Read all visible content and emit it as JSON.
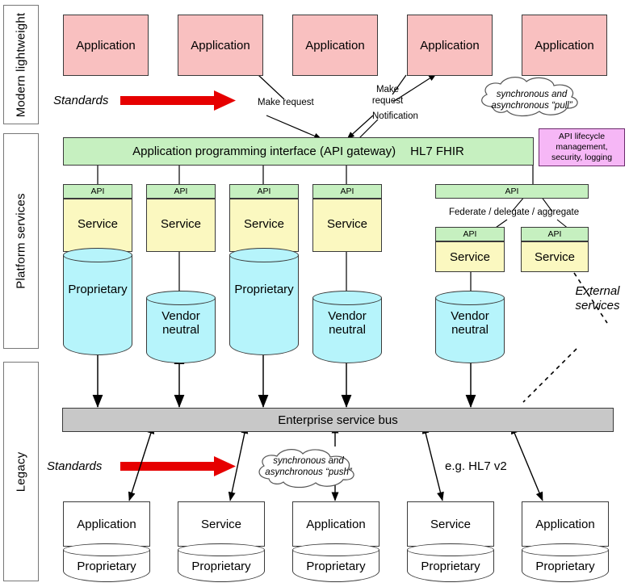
{
  "bands": [
    {
      "name": "band-modern",
      "label": "Modern lightweight"
    },
    {
      "name": "band-platform",
      "label": "Platform services"
    },
    {
      "name": "band-legacy",
      "label": "Legacy"
    }
  ],
  "top_applications": [
    {
      "label": "Application"
    },
    {
      "label": "Application"
    },
    {
      "label": "Application"
    },
    {
      "label": "Application"
    },
    {
      "label": "Application"
    }
  ],
  "standards_top": {
    "label": "Standards"
  },
  "standards_bottom": {
    "label": "Standards"
  },
  "flow_annotations": {
    "make_request_1": "Make request",
    "make_request_2": "Make\nrequest",
    "notification": "Notification"
  },
  "cloud_pull": {
    "text": "synchronous and\nasynchronous “pull”"
  },
  "cloud_push": {
    "text": "synchronous and\nasynchronous “push”"
  },
  "api_gateway": {
    "title": "Application programming interface (API gateway)",
    "standard": "HL7 FHIR"
  },
  "api_lifecycle_note": {
    "text": "API lifecycle management, security, logging"
  },
  "platform_columns": [
    {
      "api": "API",
      "service": "Service",
      "store": "Proprietary",
      "store_style": "overlap"
    },
    {
      "api": "API",
      "service": "Service",
      "store": "Vendor\nneutral",
      "store_style": "detached"
    },
    {
      "api": "API",
      "service": "Service",
      "store": "Proprietary",
      "store_style": "overlap"
    },
    {
      "api": "API",
      "service": "Service",
      "store": "Vendor\nneutral",
      "store_style": "detached"
    }
  ],
  "federation": {
    "parent_api": "API",
    "label": "Federate / delegate / aggregate",
    "children": [
      {
        "api": "API",
        "service": "Service",
        "store": "Vendor\nneutral"
      },
      {
        "api": "API",
        "service": "Service",
        "store": null
      }
    ]
  },
  "external_services": {
    "label": "External\nservices"
  },
  "enterprise_service_bus": {
    "label": "Enterprise service bus"
  },
  "legacy_standard_note": {
    "label": "e.g. HL7 v2"
  },
  "legacy_systems": [
    {
      "top": "Application",
      "store": "Proprietary"
    },
    {
      "top": "Service",
      "store": "Proprietary"
    },
    {
      "top": "Application",
      "store": "Proprietary"
    },
    {
      "top": "Service",
      "store": "Proprietary"
    },
    {
      "top": "Application",
      "store": "Proprietary"
    }
  ],
  "colors": {
    "application": "#f9c0c0",
    "api": "#c6f0c0",
    "service": "#fbf8c0",
    "datastore": "#b6f4fb",
    "esb": "#c8c8c8",
    "note": "#f6b7f6",
    "arrow_red": "#e60000",
    "stroke": "#3a3a3a"
  }
}
